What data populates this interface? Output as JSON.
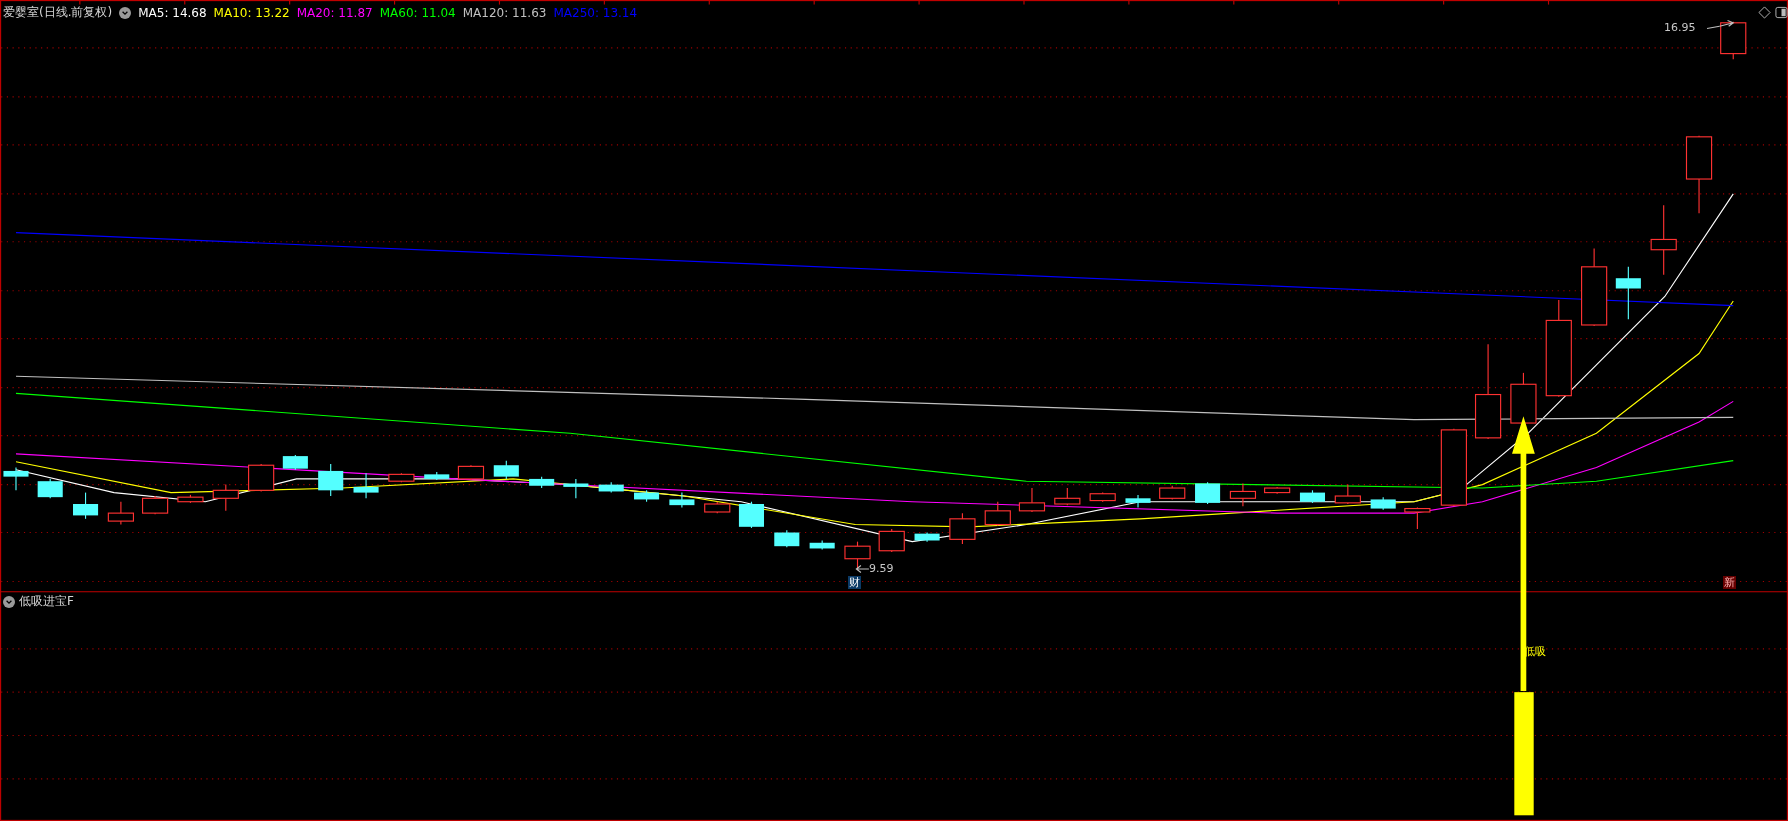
{
  "header": {
    "title": "爱婴室(日线.前复权)",
    "indicators": [
      {
        "label": "MA5: 14.68",
        "color": "#ffffff"
      },
      {
        "label": "MA10: 13.22",
        "color": "#ffff00"
      },
      {
        "label": "MA20: 11.87",
        "color": "#ff00ff"
      },
      {
        "label": "MA60: 11.04",
        "color": "#00ff00"
      },
      {
        "label": "MA120: 11.63",
        "color": "#c0c0c0"
      },
      {
        "label": "MA250: 13.14",
        "color": "#0000ff"
      }
    ]
  },
  "price_labels": {
    "high": "16.95",
    "low": "9.59"
  },
  "markers": [
    {
      "kind": "finance",
      "text": "财"
    },
    {
      "kind": "new",
      "text": "新"
    }
  ],
  "lower_panel": {
    "title": "低吸进宝F",
    "signal_label": "低吸"
  }
}
